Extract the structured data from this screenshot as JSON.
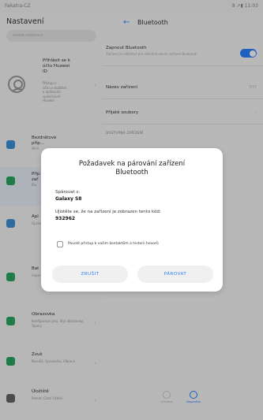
{
  "status_bar": {
    "carrier": "Fakatra-CZ",
    "right": "8 ↗▮ 11:03"
  },
  "settings": {
    "title": "Nastavení",
    "search_placeholder": "Hledat nastavení",
    "account": {
      "name_lines": [
        "Přihlásit se k",
        "účtu Huawei",
        "ID"
      ],
      "sub_lines": [
        "Přístup k",
        "účtu a službám",
        "a aplikacím",
        "společnosti",
        "Huawei"
      ]
    },
    "items": [
      {
        "title_lines": [
          "Bezdrátové",
          "příp..."
        ],
        "sub": "Wi-Fi",
        "color": "#3b8fd6"
      },
      {
        "title_lines": [
          "Přip",
          "zař"
        ],
        "sub": "Blu",
        "color": "#2aa661"
      },
      {
        "title_lines": [
          "Apl"
        ],
        "sub": "Oprávění, apl...",
        "color": "#3b8fd6"
      },
      {
        "title_lines": [
          "Bat"
        ],
        "sub": "Úsporný režim, baterie",
        "color": "#2aa661"
      },
      {
        "title_lines": [
          "Obrazovka"
        ],
        "sub": "Konfigurace jasu, Styl obrazovky, Tapety",
        "color": "#2aa661"
      },
      {
        "title_lines": [
          "Zvuk"
        ],
        "sub": "Nerušit, Vyzvánění, Vibrace",
        "color": "#2aa661"
      },
      {
        "title_lines": [
          "Úložiště"
        ],
        "sub": "Paměť, Čisté čištění",
        "color": "#666666"
      }
    ]
  },
  "bluetooth": {
    "title": "Bluetooth",
    "enable_title": "Zapnout Bluetooth",
    "enable_sub": "Zařízení je viditelné pro všechna okolní zařízení Bluetooth",
    "enabled": true,
    "device_name_label": "Název zařízení",
    "device_name_value": "TITY",
    "received_files_label": "Přijaté soubory",
    "section_available": "DOSTUPNÁ ZAŘÍZENÍ"
  },
  "nav": {
    "scan": "Vyhledat",
    "help": "Nápověda"
  },
  "dialog": {
    "title_line1": "Požadavek na párování zařízení",
    "title_line2": "Bluetooth",
    "pair_with_label": "Spárovat s:",
    "device": "Galaxy S8",
    "code_message": "Ujistěte se, že na zařízení je zobrazen tento kód:",
    "code": "932962",
    "checkbox_label": "Povolit přístup k vašim kontaktům a historii hovorů",
    "checkbox_checked": false,
    "cancel_label": "ZRUŠIT",
    "pair_label": "PÁROVAT"
  }
}
